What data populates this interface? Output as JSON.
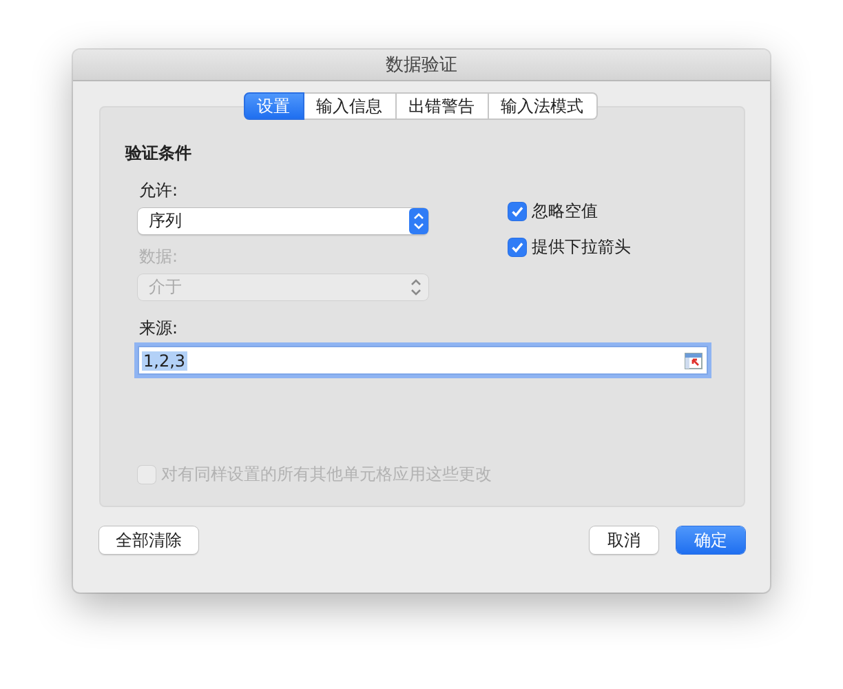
{
  "window": {
    "title": "数据验证"
  },
  "tabs": [
    {
      "label": "设置",
      "selected": true
    },
    {
      "label": "输入信息",
      "selected": false
    },
    {
      "label": "出错警告",
      "selected": false
    },
    {
      "label": "输入法模式",
      "selected": false
    }
  ],
  "section_title": "验证条件",
  "allow": {
    "label": "允许:",
    "value": "序列",
    "disabled": false
  },
  "data": {
    "label": "数据:",
    "value": "介于",
    "disabled": true
  },
  "options": [
    {
      "label": "忽略空值",
      "checked": true,
      "disabled": false
    },
    {
      "label": "提供下拉箭头",
      "checked": true,
      "disabled": false
    }
  ],
  "source": {
    "label": "来源:",
    "value": "1,2,3",
    "focused": true,
    "text_selected": true
  },
  "apply_all": {
    "label": "对有同样设置的所有其他单元格应用这些更改",
    "checked": false,
    "disabled": true
  },
  "buttons_left": [
    {
      "label": "全部清除",
      "kind": "plain"
    }
  ],
  "buttons_right": [
    {
      "label": "取消",
      "kind": "plain"
    },
    {
      "label": "确定",
      "kind": "default"
    }
  ]
}
